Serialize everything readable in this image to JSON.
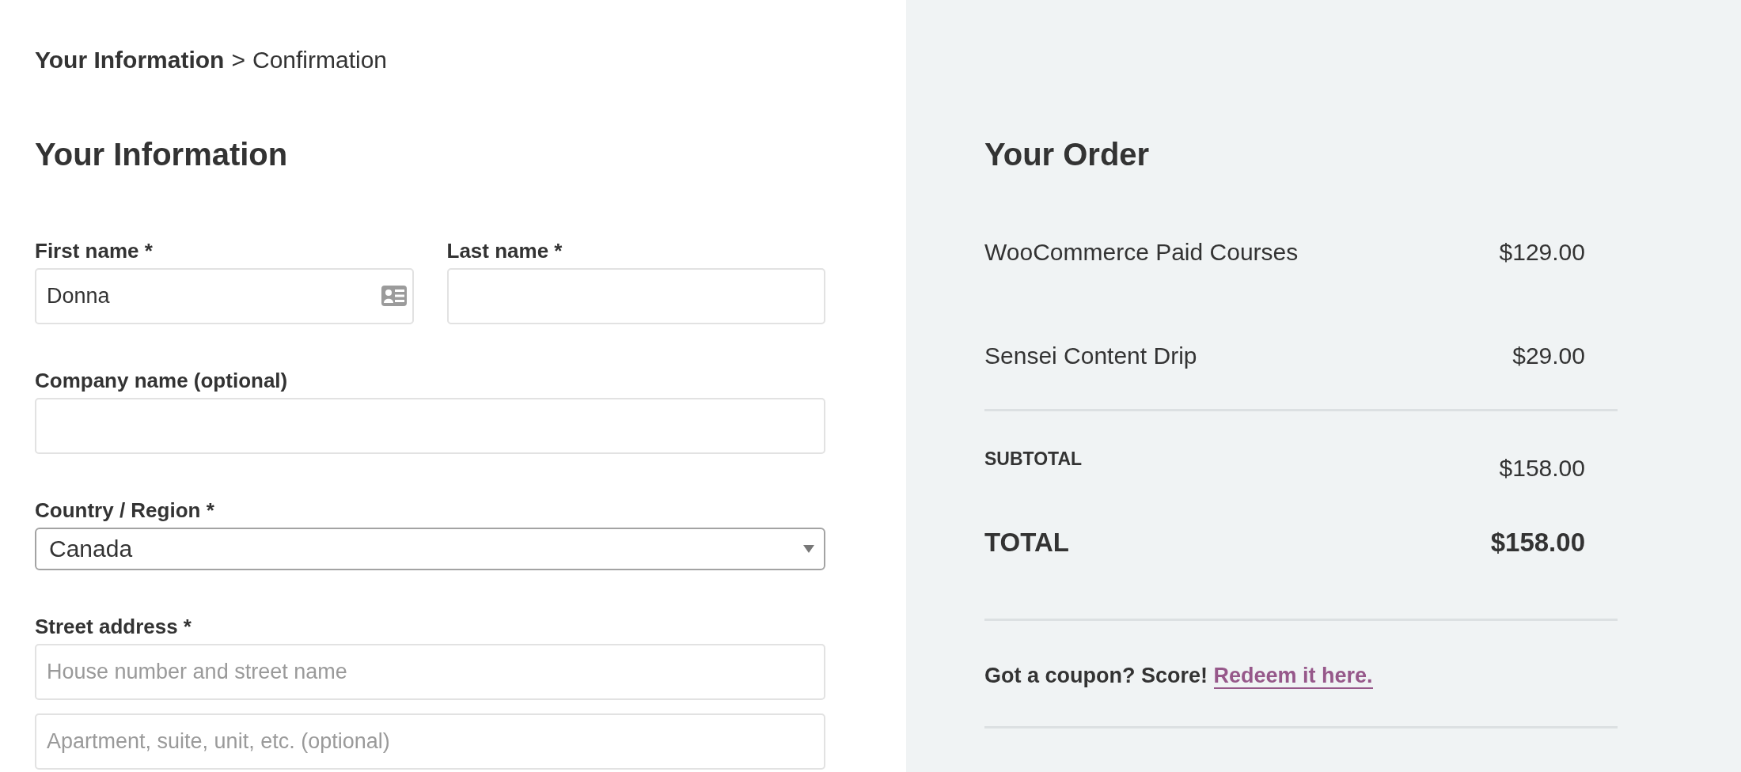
{
  "breadcrumb": {
    "separator": ">",
    "steps": [
      {
        "label": "Your Information",
        "selected": true
      },
      {
        "label": "Confirmation",
        "selected": false
      }
    ]
  },
  "information": {
    "title": "Your Information",
    "rows": [
      [
        {
          "kind": "text",
          "label": "First name *",
          "inputs": [
            {
              "value": "Donna",
              "contact_card_icon": true
            }
          ]
        },
        {
          "kind": "text",
          "label": "Last name *",
          "inputs": [
            {
              "contact_card_icon": false
            }
          ]
        }
      ],
      [
        {
          "kind": "text",
          "label": "Company name (optional)",
          "inputs": [
            {
              "contact_card_icon": false
            }
          ]
        }
      ],
      [
        {
          "kind": "select",
          "label": "Country / Region *",
          "value": "Canada"
        }
      ],
      [
        {
          "kind": "text",
          "label": "Street address *",
          "inputs": [
            {
              "placeholder": "House number and street name",
              "contact_card_icon": false
            },
            {
              "placeholder": "Apartment, suite, unit, etc. (optional)",
              "contact_card_icon": false
            }
          ]
        }
      ]
    ]
  },
  "order": {
    "title": "Your Order",
    "items": [
      {
        "name": "WooCommerce Paid Courses",
        "price": "$129.00"
      },
      {
        "name": "Sensei Content Drip",
        "price": "$29.00"
      }
    ],
    "subtotal": {
      "label": "SUBTOTAL",
      "value": "$158.00"
    },
    "total": {
      "label": "TOTAL",
      "value": "$158.00"
    },
    "coupon": {
      "text": "Got a coupon? Score!",
      "link": "Redeem it here."
    }
  }
}
